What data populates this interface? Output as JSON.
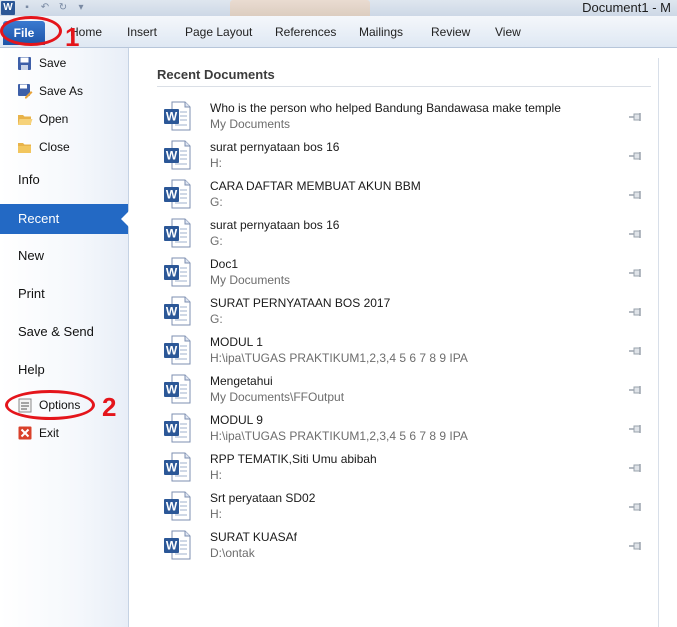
{
  "window": {
    "title": "Document1 - M",
    "logo_letter": "W"
  },
  "ribbon": {
    "tabs": [
      "File",
      "Home",
      "Insert",
      "Page Layout",
      "References",
      "Mailings",
      "Review",
      "View"
    ]
  },
  "backstage": {
    "commands": [
      {
        "label": "Save",
        "icon": "save-icon"
      },
      {
        "label": "Save As",
        "icon": "save-as-icon"
      },
      {
        "label": "Open",
        "icon": "open-folder-icon"
      },
      {
        "label": "Close",
        "icon": "close-folder-icon"
      }
    ],
    "sections": [
      "Info",
      "Recent",
      "New",
      "Print",
      "Save & Send",
      "Help"
    ],
    "selected": "Recent",
    "bottom_commands": [
      {
        "label": "Options",
        "icon": "options-icon"
      },
      {
        "label": "Exit",
        "icon": "exit-icon"
      }
    ]
  },
  "recent": {
    "title": "Recent Documents",
    "documents": [
      {
        "name": "Who is the person who helped Bandung Bandawasa make temple",
        "path": "My Documents"
      },
      {
        "name": "surat pernyataan bos 16",
        "path": "H:"
      },
      {
        "name": "CARA DAFTAR MEMBUAT AKUN BBM",
        "path": "G:"
      },
      {
        "name": "surat pernyataan bos 16",
        "path": "G:"
      },
      {
        "name": "Doc1",
        "path": "My Documents"
      },
      {
        "name": "SURAT PERNYATAAN BOS 2017",
        "path": "G:"
      },
      {
        "name": "MODUL 1",
        "path": "H:\\ipa\\TUGAS PRAKTIKUM1,2,3,4 5 6 7 8 9 IPA"
      },
      {
        "name": "Mengetahui",
        "path": "My Documents\\FFOutput"
      },
      {
        "name": "MODUL 9",
        "path": "H:\\ipa\\TUGAS PRAKTIKUM1,2,3,4 5 6 7 8 9 IPA"
      },
      {
        "name": "RPP TEMATIK,Siti Umu abibah",
        "path": "H:"
      },
      {
        "name": "Srt peryataan SD02",
        "path": "H:"
      },
      {
        "name": "SURAT KUASAf",
        "path": "D:\\ontak"
      }
    ]
  },
  "annotations": [
    {
      "label": "1",
      "color": "#e4151b"
    },
    {
      "label": "2",
      "color": "#e4151b"
    }
  ],
  "colors": {
    "accent": "#2369c4",
    "annotation": "#e4151b",
    "word_blue": "#2b5797"
  }
}
